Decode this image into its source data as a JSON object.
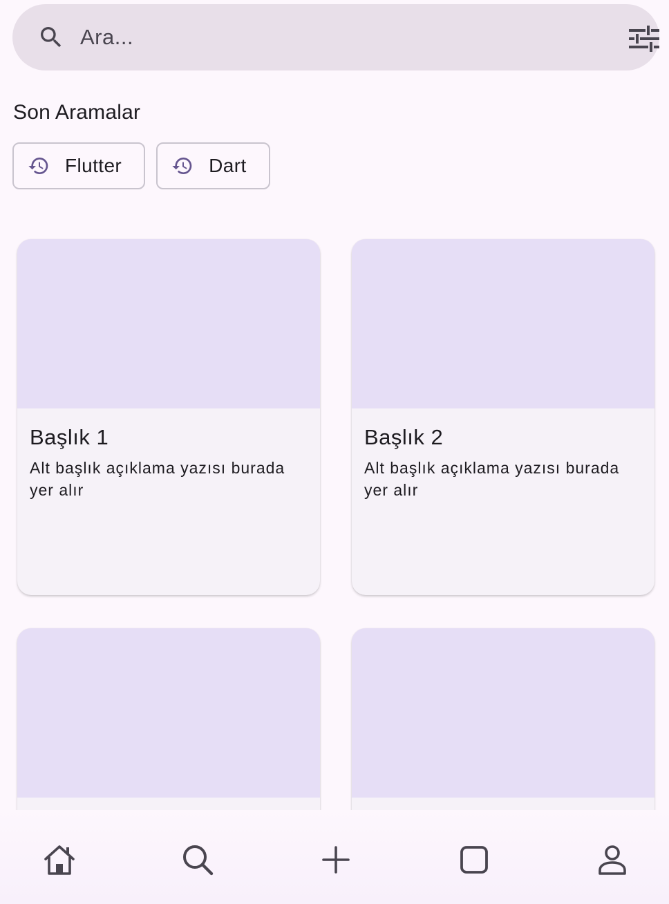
{
  "search": {
    "placeholder": "Ara...",
    "leading_icon": "search-icon",
    "trailing_icon": "tune-icon"
  },
  "recent": {
    "title": "Son Aramalar",
    "chips": [
      {
        "label": "Flutter",
        "icon": "history-icon"
      },
      {
        "label": "Dart",
        "icon": "history-icon"
      }
    ]
  },
  "cards": [
    {
      "title": "Başlık 1",
      "subtitle": "Alt başlık açıklama yazısı burada yer alır"
    },
    {
      "title": "Başlık 2",
      "subtitle": "Alt başlık açıklama yazısı burada yer alır"
    },
    {
      "title": "",
      "subtitle": ""
    },
    {
      "title": "",
      "subtitle": ""
    }
  ],
  "bottom_nav": {
    "items": [
      "home-icon",
      "search-icon",
      "add-icon",
      "square-icon",
      "person-icon"
    ]
  },
  "colors": {
    "background": "#fdf7fd",
    "search_bar": "#e8dfe9",
    "card_media": "#e6def6",
    "card_body": "#f6f2f8",
    "accent": "#65558f",
    "icon": "#49454f"
  }
}
